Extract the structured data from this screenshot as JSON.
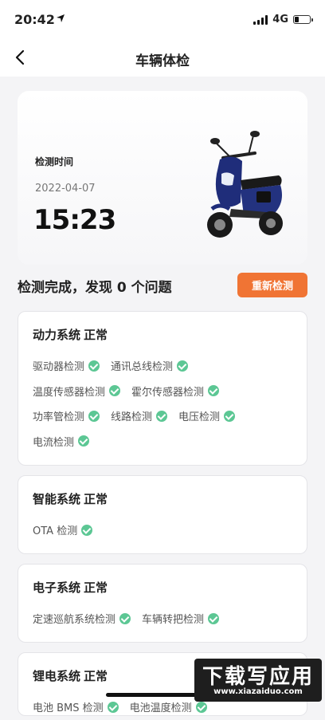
{
  "status_bar": {
    "time": "20:42",
    "network": "4G"
  },
  "nav": {
    "title": "车辆体检"
  },
  "hero": {
    "label": "检测时间",
    "date": "2022-04-07",
    "time": "15:23"
  },
  "summary": {
    "text": "检测完成，发现 0 个问题",
    "recheck_label": "重新检测"
  },
  "sections": [
    {
      "name": "动力系统",
      "status": "正常",
      "items": [
        "驱动器检测",
        "通讯总线检测",
        "温度传感器检测",
        "霍尔传感器检测",
        "功率管检测",
        "线路检测",
        "电压检测",
        "电流检测"
      ]
    },
    {
      "name": "智能系统",
      "status": "正常",
      "items": [
        "OTA 检测"
      ]
    },
    {
      "name": "电子系统",
      "status": "正常",
      "items": [
        "定速巡航系统检测",
        "车辆转把检测"
      ]
    },
    {
      "name": "锂电系统",
      "status": "正常",
      "items": [
        "电池 BMS 检测",
        "电池温度检测"
      ]
    }
  ],
  "watermark": {
    "text": "下载写应用",
    "url": "www.xiazaiduo.com"
  },
  "colors": {
    "accent": "#f07434",
    "check": "#5cc794",
    "scooter_body": "#1f2d7a"
  }
}
